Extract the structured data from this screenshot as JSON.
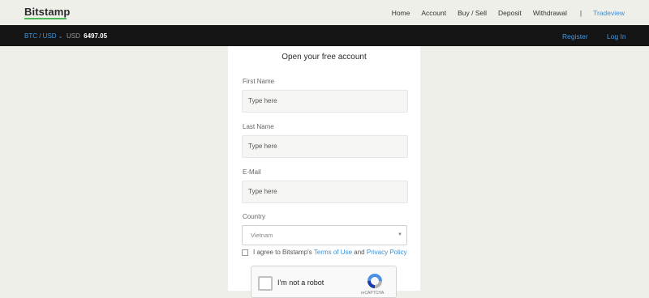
{
  "header": {
    "logo": "Bitstamp",
    "menu": [
      "Home",
      "Account",
      "Buy / Sell",
      "Deposit",
      "Withdrawal"
    ],
    "separator": "|",
    "tradeview": "Tradeview"
  },
  "ticker": {
    "pair": "BTC / USD",
    "currency": "USD",
    "price": "6497.05",
    "register": "Register",
    "login": "Log In"
  },
  "form": {
    "title": "Open your free account",
    "first_name": {
      "label": "First Name",
      "placeholder": "Type here"
    },
    "last_name": {
      "label": "Last Name",
      "placeholder": "Type here"
    },
    "email": {
      "label": "E-Mail",
      "placeholder": "Type here"
    },
    "country": {
      "label": "Country",
      "value": "Vietnam"
    },
    "agree": {
      "prefix": "I agree to Bitstamp's",
      "terms": "Terms of Use",
      "and": "and",
      "policy": "Privacy Policy"
    },
    "captcha": {
      "label": "I'm not a robot",
      "brand": "reCAPTCHA"
    }
  },
  "colors": {
    "accent": "#3d8fd1",
    "logo_underline": "#4cbb59",
    "bar": "#141414"
  }
}
